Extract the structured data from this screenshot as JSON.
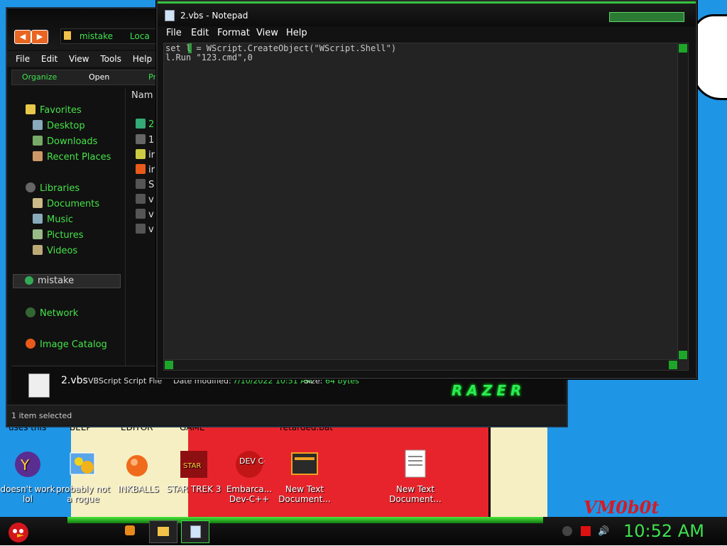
{
  "explorer": {
    "address_folder": "mistake",
    "address_location": "Loca",
    "menu": [
      "File",
      "Edit",
      "View",
      "Tools",
      "Help"
    ],
    "cmd": {
      "organize": "Organize",
      "open": "Open",
      "more": "Pr"
    },
    "nav": {
      "favorites": "Favorites",
      "desktop": "Desktop",
      "downloads": "Downloads",
      "recent": "Recent Places",
      "libraries": "Libraries",
      "documents": "Documents",
      "music": "Music",
      "pictures": "Pictures",
      "videos": "Videos",
      "selected": "mistake",
      "network": "Network",
      "image_catalog": "Image Catalog"
    },
    "column_name": "Nam",
    "files": [
      "2",
      "1",
      "ir",
      "ir",
      "S",
      "v",
      "v",
      "v"
    ],
    "details": {
      "name": "2.vbs",
      "type": "VBScript Script File",
      "date_label": "Date modified:",
      "date_value": "7/10/2022 10:51 AM",
      "size_label": "Size:",
      "size_value": "64 bytes",
      "logo": "RAZER"
    },
    "status": "1 item selected"
  },
  "notepad": {
    "title": "2.vbs - Notepad",
    "menu": [
      "File",
      "Edit",
      "Format",
      "View",
      "Help"
    ],
    "lines": [
      "set l = WScript.CreateObject(\"WScript.Shell\")",
      "l.Run \"123.cmd\",0"
    ]
  },
  "desktop": {
    "top_labels": [
      "uses this",
      "BEEP",
      "EDITOR",
      "GAME",
      "retarded.bat"
    ],
    "icons": [
      {
        "label": "doesn't work lol",
        "icon": "yahoo-icon"
      },
      {
        "label": "probably not a rogue",
        "icon": "gears-icon"
      },
      {
        "label": "INKBALLS",
        "icon": "inkball-icon"
      },
      {
        "label": "STAR TREK 3",
        "icon": "star-wars-icon"
      },
      {
        "label": "Embarca... Dev-C++",
        "icon": "devcpp-icon"
      },
      {
        "label": "New Text Document...",
        "icon": "text-doc-icon"
      },
      {
        "label": "New Text Document...",
        "icon": "text-doc-icon"
      }
    ],
    "devcpp_badge": "DEV C++",
    "wallpaper_signature": "VM0b0t"
  },
  "taskbar": {
    "clock": "10:52 AM"
  },
  "colors": {
    "accent_green": "#3ee24e",
    "desktop_blue": "#1f95e6",
    "wall_red": "#e7242c"
  }
}
